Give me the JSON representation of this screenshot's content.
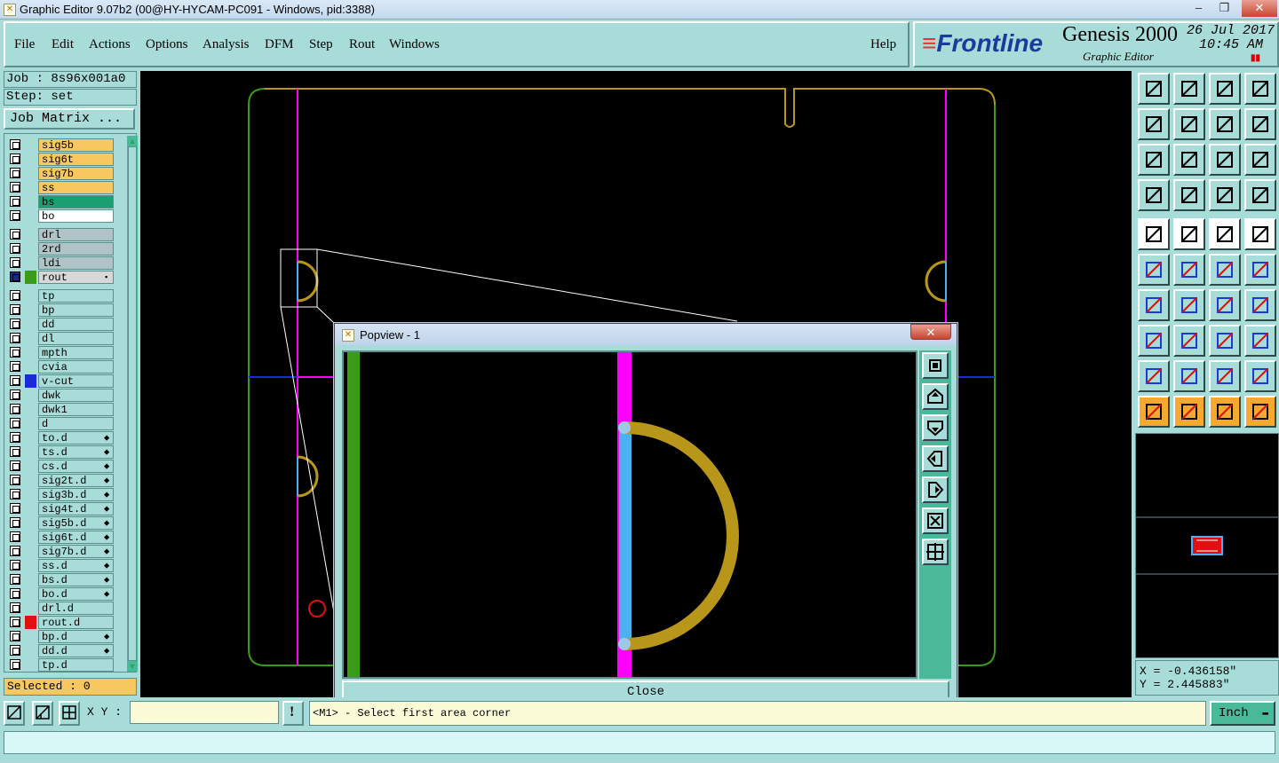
{
  "window": {
    "title": "Graphic Editor 9.07b2 (00@HY-HYCAM-PC091 - Windows, pid:3388)"
  },
  "menu": [
    "File",
    "Edit",
    "Actions",
    "Options",
    "Analysis",
    "DFM",
    "Step",
    "Rout",
    "Windows"
  ],
  "help_label": "Help",
  "brand": {
    "logo": "Frontline",
    "product": "Genesis 2000",
    "subtitle": "Graphic Editor",
    "date": "26 Jul 2017",
    "time": "10:45 AM"
  },
  "job": {
    "job": "Job : 8s96x001a0",
    "step": "Step: set",
    "matrix_button": "Job Matrix ..."
  },
  "layers": [
    {
      "name": "sig5b",
      "bg": "#f8c860",
      "sw": ""
    },
    {
      "name": "sig6t",
      "bg": "#f8c860",
      "sw": ""
    },
    {
      "name": "sig7b",
      "bg": "#f8c860",
      "sw": ""
    },
    {
      "name": "ss",
      "bg": "#f8c860",
      "sw": ""
    },
    {
      "name": "bs",
      "bg": "#1aa070",
      "sw": ""
    },
    {
      "name": "bo",
      "bg": "#ffffff",
      "sw": ""
    },
    {
      "name": "drl",
      "bg": "#b0c4c8",
      "sw": ""
    },
    {
      "name": "2rd",
      "bg": "#b0c4c8",
      "sw": ""
    },
    {
      "name": "ldi",
      "bg": "#b0c4c8",
      "sw": ""
    },
    {
      "name": "rout",
      "bg": "#d8d8d8",
      "sw": "#3a9a1a",
      "mark": "▪"
    },
    {
      "name": "tp",
      "bg": "#a7dcd8",
      "sw": ""
    },
    {
      "name": "bp",
      "bg": "#a7dcd8",
      "sw": ""
    },
    {
      "name": "dd",
      "bg": "#a7dcd8",
      "sw": ""
    },
    {
      "name": "dl",
      "bg": "#a7dcd8",
      "sw": ""
    },
    {
      "name": "mpth",
      "bg": "#a7dcd8",
      "sw": ""
    },
    {
      "name": "cvia",
      "bg": "#a7dcd8",
      "sw": ""
    },
    {
      "name": "v-cut",
      "bg": "#a7dcd8",
      "sw": "#1a2ad8"
    },
    {
      "name": "dwk",
      "bg": "#a7dcd8",
      "sw": ""
    },
    {
      "name": "dwk1",
      "bg": "#a7dcd8",
      "sw": ""
    },
    {
      "name": "d",
      "bg": "#a7dcd8",
      "sw": ""
    },
    {
      "name": "to.d",
      "bg": "#a7dcd8",
      "sw": "",
      "mark": "⬥"
    },
    {
      "name": "ts.d",
      "bg": "#a7dcd8",
      "sw": "",
      "mark": "⬥"
    },
    {
      "name": "cs.d",
      "bg": "#a7dcd8",
      "sw": "",
      "mark": "⬥"
    },
    {
      "name": "sig2t.d",
      "bg": "#a7dcd8",
      "sw": "",
      "mark": "⬥"
    },
    {
      "name": "sig3b.d",
      "bg": "#a7dcd8",
      "sw": "",
      "mark": "⬥"
    },
    {
      "name": "sig4t.d",
      "bg": "#a7dcd8",
      "sw": "",
      "mark": "⬥"
    },
    {
      "name": "sig5b.d",
      "bg": "#a7dcd8",
      "sw": "",
      "mark": "⬥"
    },
    {
      "name": "sig6t.d",
      "bg": "#a7dcd8",
      "sw": "",
      "mark": "⬥"
    },
    {
      "name": "sig7b.d",
      "bg": "#a7dcd8",
      "sw": "",
      "mark": "⬥"
    },
    {
      "name": "ss.d",
      "bg": "#a7dcd8",
      "sw": "",
      "mark": "⬥"
    },
    {
      "name": "bs.d",
      "bg": "#a7dcd8",
      "sw": "",
      "mark": "⬥"
    },
    {
      "name": "bo.d",
      "bg": "#a7dcd8",
      "sw": "",
      "mark": "⬥"
    },
    {
      "name": "drl.d",
      "bg": "#a7dcd8",
      "sw": ""
    },
    {
      "name": "rout.d",
      "bg": "#a7dcd8",
      "sw": "#e01010"
    },
    {
      "name": "bp.d",
      "bg": "#a7dcd8",
      "sw": "",
      "mark": "⬥"
    },
    {
      "name": "dd.d",
      "bg": "#a7dcd8",
      "sw": "",
      "mark": "⬥"
    },
    {
      "name": "tp.d",
      "bg": "#a7dcd8",
      "sw": ""
    }
  ],
  "selected": "Selected : 0",
  "popview": {
    "title": "Popview - 1",
    "close_label": "Close"
  },
  "coords": {
    "x": "X = -0.436158\"",
    "y": "Y = 2.445883\""
  },
  "bottom": {
    "xy_label": "X Y :",
    "xy_value": "",
    "message": "<M1> - Select first area corner",
    "unit": "Inch"
  },
  "colors": {
    "panel": "#a7dcd8",
    "accent": "#49b99a",
    "outline": "#b8961a",
    "magenta": "#ff00ff",
    "cyan": "#4ab2f0",
    "green": "#3a9a1a"
  }
}
